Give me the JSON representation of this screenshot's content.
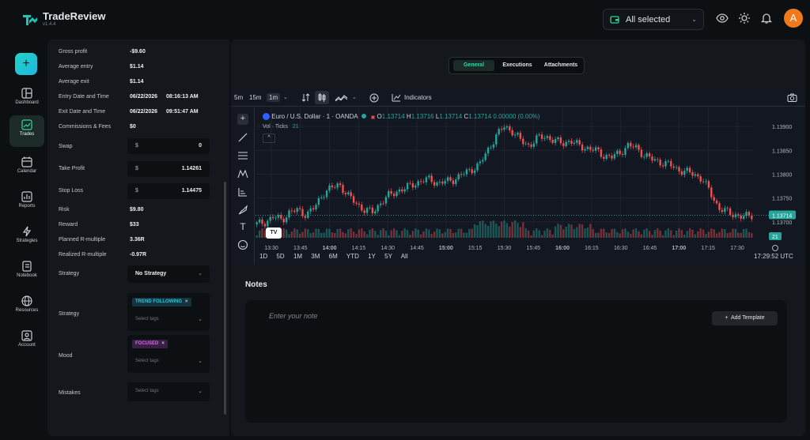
{
  "app": {
    "name": "TradeReview",
    "version": "v1.4.4"
  },
  "header": {
    "account_select": "All selected",
    "avatar_initial": "A"
  },
  "sidebar": {
    "items": [
      {
        "label": "Dashboard",
        "icon": "dashboard-icon",
        "active": false
      },
      {
        "label": "Trades",
        "icon": "trades-icon",
        "active": true
      },
      {
        "label": "Calendar",
        "icon": "calendar-icon",
        "active": false
      },
      {
        "label": "Reports",
        "icon": "reports-icon",
        "active": false
      },
      {
        "label": "Strategies",
        "icon": "strategies-icon",
        "active": false
      },
      {
        "label": "Notebook",
        "icon": "notebook-icon",
        "active": false
      },
      {
        "label": "Resources",
        "icon": "resources-icon",
        "active": false
      },
      {
        "label": "Account",
        "icon": "account-icon",
        "active": false
      }
    ]
  },
  "details": {
    "gross_profit": {
      "label": "Gross profit",
      "value": "-$9.60"
    },
    "average_entry": {
      "label": "Average entry",
      "value": "$1.14"
    },
    "average_exit": {
      "label": "Average exit",
      "value": "$1.14"
    },
    "entry_dt": {
      "label": "Entry Date and Time",
      "date": "06/22/2026",
      "time": "08:16:13 AM"
    },
    "exit_dt": {
      "label": "Exit Date and Time",
      "date": "06/22/2026",
      "time": "09:51:47 AM"
    },
    "commissions": {
      "label": "Commissions & Fees",
      "value": "$0"
    },
    "swap": {
      "label": "Swap",
      "currency": "$",
      "value": "0"
    },
    "take_profit": {
      "label": "Take Profit",
      "currency": "$",
      "value": "1.14261"
    },
    "stop_loss": {
      "label": "Stop Loss",
      "currency": "$",
      "value": "1.14475"
    },
    "risk": {
      "label": "Risk",
      "value": "$9.80"
    },
    "reward": {
      "label": "Reward",
      "value": "$33"
    },
    "planned_r": {
      "label": "Planned R-multiple",
      "value": "3.36R"
    },
    "realized_r": {
      "label": "Realized R-multiple",
      "value": "-0.97R"
    },
    "strategy_select": {
      "label": "Strategy",
      "value": "No Strategy"
    },
    "strategy_tags": {
      "label": "Strategy",
      "tag": "TREND FOLLOWING",
      "placeholder": "Select tags"
    },
    "mood": {
      "label": "Mood",
      "tag": "FOCUSED",
      "placeholder": "Select tags"
    },
    "mistakes": {
      "label": "Mistakes",
      "placeholder": "Select tags"
    }
  },
  "tabs": [
    {
      "label": "General",
      "active": true
    },
    {
      "label": "Executions",
      "active": false
    },
    {
      "label": "Attachments",
      "active": false
    }
  ],
  "chart_toolbar": {
    "intervals": [
      "5m",
      "15m",
      "1m"
    ],
    "active_interval": "1m",
    "indicators": "Indicators"
  },
  "chart_legend": {
    "symbol": "Euro / U.S. Dollar · 1 · OANDA",
    "o_label": "O",
    "o": "1.13714",
    "h_label": "H",
    "h": "1.13716",
    "l_label": "L",
    "l": "1.13714",
    "c_label": "C",
    "c": "1.13714",
    "change": "0.00000 (0.00%)",
    "vol_label": "Vol · Ticks",
    "vol_value": "21"
  },
  "chart_data": {
    "type": "candlestick",
    "price_ticks": [
      "1.13900",
      "1.13850",
      "1.13800",
      "1.13750",
      "1.13700"
    ],
    "last_price": "1.13714",
    "last_volume": "21",
    "time_ticks": [
      "13:30",
      "13:45",
      "14:00",
      "14:15",
      "14:30",
      "14:45",
      "15:00",
      "15:15",
      "15:30",
      "15:45",
      "16:00",
      "16:15",
      "16:30",
      "16:45",
      "17:00",
      "17:15",
      "17:30"
    ],
    "close_series": [
      1.13695,
      1.137,
      1.1371,
      1.13705,
      1.1372,
      1.13725,
      1.13715,
      1.1373,
      1.1376,
      1.1377,
      1.1378,
      1.13755,
      1.1374,
      1.13725,
      1.1372,
      1.1374,
      1.13755,
      1.13765,
      1.1377,
      1.1378,
      1.13785,
      1.1379,
      1.1378,
      1.13785,
      1.1379,
      1.138,
      1.1381,
      1.1382,
      1.1385,
      1.1388,
      1.139,
      1.1389,
      1.1387,
      1.1386,
      1.13875,
      1.1388,
      1.1387,
      1.13865,
      1.1387,
      1.1386,
      1.13855,
      1.1385,
      1.1384,
      1.13835,
      1.13845,
      1.1386,
      1.13855,
      1.1384,
      1.1383,
      1.13825,
      1.1382,
      1.1381,
      1.13805,
      1.138,
      1.1379,
      1.1376,
      1.1373,
      1.1372,
      1.13715,
      1.1371,
      1.13714
    ],
    "y_range": [
      1.1368,
      1.1392
    ],
    "grid": true
  },
  "chart_ranges": [
    "1D",
    "5D",
    "1M",
    "3M",
    "6M",
    "YTD",
    "1Y",
    "5Y",
    "All"
  ],
  "chart_clock": "17:29:52 UTC",
  "notes": {
    "title": "Notes",
    "placeholder": "Enter your note",
    "add_template": "Add Template"
  }
}
